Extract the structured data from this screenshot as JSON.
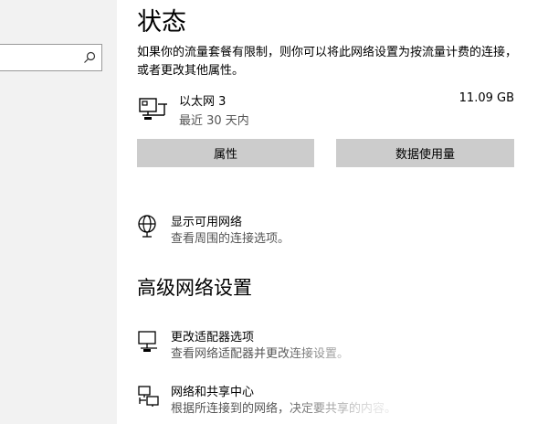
{
  "search": {
    "placeholder": ""
  },
  "status": {
    "title": "状态",
    "description": "如果你的流量套餐有限制，则你可以将此网络设置为按流量计费的连接，或者更改其他属性。",
    "connection": {
      "name": "以太网 3",
      "period": "最近 30 天内",
      "usage": "11.09 GB",
      "icon": "ethernet-monitor-icon"
    },
    "buttons": {
      "properties": "属性",
      "data_usage": "数据使用量"
    },
    "available_networks": {
      "title": "显示可用网络",
      "subtitle": "查看周围的连接选项。",
      "icon": "globe-network-icon"
    }
  },
  "advanced": {
    "title": "高级网络设置",
    "adapter_options": {
      "title": "更改适配器选项",
      "subtitle": "查看网络适配器并更改连接设置。",
      "icon": "network-adapter-icon"
    },
    "sharing_center": {
      "title": "网络和共享中心",
      "subtitle": "根据所连接到的网络，决定要共享的内容。",
      "icon": "sharing-center-icon"
    }
  },
  "colors": {
    "sidebar_bg": "#f2f2f2",
    "button_bg": "#cccccc",
    "secondary_text": "#555555"
  }
}
